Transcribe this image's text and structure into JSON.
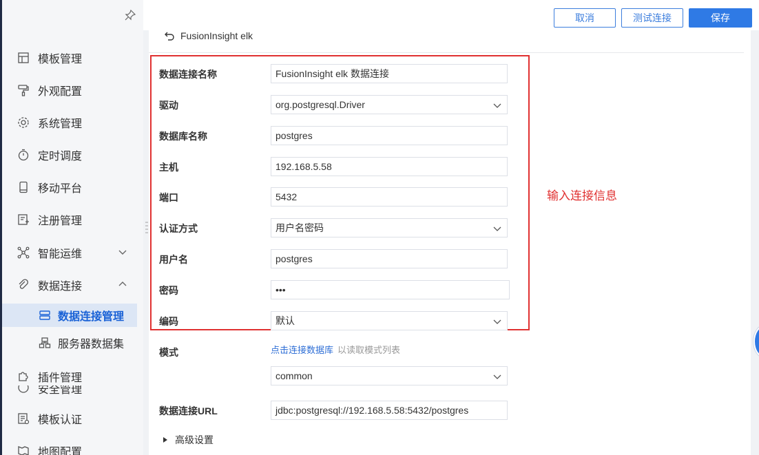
{
  "sidebar": {
    "items": [
      {
        "label": "模板管理",
        "icon": "template-icon"
      },
      {
        "label": "外观配置",
        "icon": "paint-roller-icon"
      },
      {
        "label": "系统管理",
        "icon": "gear-icon"
      },
      {
        "label": "定时调度",
        "icon": "timer-icon"
      },
      {
        "label": "移动平台",
        "icon": "mobile-icon"
      },
      {
        "label": "注册管理",
        "icon": "register-icon"
      },
      {
        "label": "智能运维",
        "icon": "network-icon"
      },
      {
        "label": "数据连接",
        "icon": "link-icon"
      },
      {
        "label": "插件管理",
        "icon": "puzzle-icon"
      },
      {
        "label": "安全管理",
        "icon": "shield-icon"
      },
      {
        "label": "模板认证",
        "icon": "certificate-icon"
      },
      {
        "label": "地图配置",
        "icon": "map-icon"
      }
    ],
    "subitems": [
      {
        "label": "数据连接管理",
        "icon": "database-connection-icon",
        "active": true
      },
      {
        "label": "服务器数据集",
        "icon": "server-dataset-icon",
        "active": false
      }
    ]
  },
  "toolbar": {
    "cancel_label": "取消",
    "test_label": "测试连接",
    "save_label": "保存"
  },
  "connection": {
    "title": "FusionInsight elk"
  },
  "form": {
    "name": {
      "label": "数据连接名称",
      "value": "FusionInsight elk 数据连接"
    },
    "driver": {
      "label": "驱动",
      "value": "org.postgresql.Driver"
    },
    "database": {
      "label": "数据库名称",
      "value": "postgres"
    },
    "host": {
      "label": "主机",
      "value": "192.168.5.58"
    },
    "port": {
      "label": "端口",
      "value": "5432"
    },
    "auth": {
      "label": "认证方式",
      "value": "用户名密码"
    },
    "username": {
      "label": "用户名",
      "value": "postgres"
    },
    "password": {
      "label": "密码",
      "value": "•••"
    },
    "encoding": {
      "label": "编码",
      "value": "默认"
    },
    "schema": {
      "label": "模式",
      "link_text": "点击连接数据库",
      "hint": "以读取模式列表",
      "value": "common"
    },
    "url": {
      "label": "数据连接URL",
      "value": "jdbc:postgresql://192.168.5.58:5432/postgres"
    },
    "advanced_label": "高级设置"
  },
  "annotation": {
    "text": "输入连接信息",
    "color": "#e03030"
  },
  "colors": {
    "accent": "#2f7ae5",
    "sidebar_active_bg": "#dce6f5",
    "sidebar_active_text": "#1a62d6"
  }
}
